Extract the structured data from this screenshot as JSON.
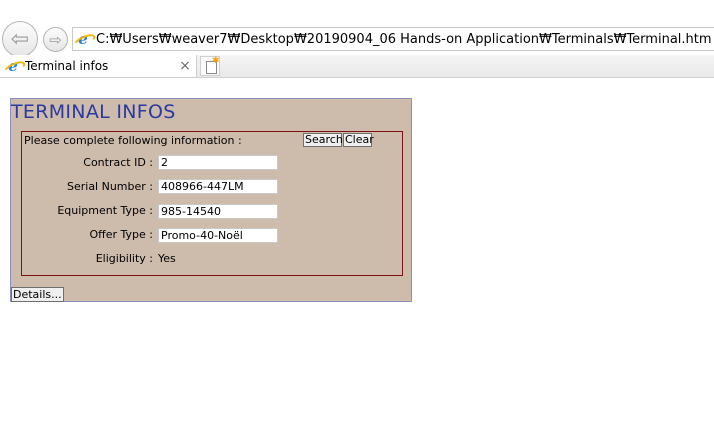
{
  "browser": {
    "address": "C:₩Users₩weaver7₩Desktop₩20190904_06 Hands-on Application₩Terminals₩Terminal.htm",
    "tab_title": "Terminal infos",
    "tab_close": "×",
    "back_glyph": "⇦",
    "forward_glyph": "⇨",
    "browser_icon": "ie-icon"
  },
  "page": {
    "title": "TERMINAL INFOS",
    "instruction": "Please complete following information :",
    "search_label": "Search",
    "clear_label": "Clear",
    "details_label": "Details...",
    "fields": [
      {
        "label": "Contract ID :",
        "value": "2"
      },
      {
        "label": "Serial Number :",
        "value": "408966-447LM"
      },
      {
        "label": "Equipment Type :",
        "value": "985-14540"
      },
      {
        "label": "Offer Type :",
        "value": "Promo-40-Noël"
      }
    ],
    "eligibility": {
      "label": "Eligibility :",
      "value": "Yes"
    }
  },
  "colors": {
    "panel_bg": "#cdbbab",
    "title": "#2b3aa0",
    "form_border": "#7d1010"
  }
}
